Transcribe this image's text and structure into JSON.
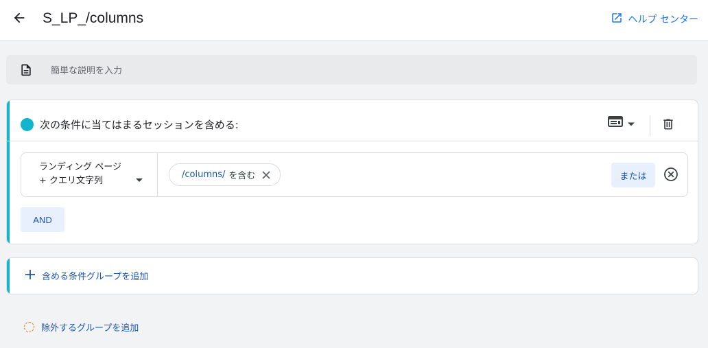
{
  "header": {
    "title": "S_LP_/columns",
    "help_label": "ヘルプ センター",
    "back_icon": "arrow-back-icon",
    "help_icon": "open-in-new-icon"
  },
  "description": {
    "placeholder": "簡単な説明を入力",
    "icon": "document-icon"
  },
  "include_group": {
    "title": "次の条件に当てはまるセッションを含める:",
    "accent_color": "#12b5cb",
    "condition": {
      "dimension": "ランディング ページ + クエリ文字列",
      "value": "/columns/",
      "operator": "を含む",
      "or_label": "または"
    },
    "and_label": "AND"
  },
  "add_include_label": "含める条件グループを追加",
  "add_exclude_label": "除外するグループを追加",
  "colors": {
    "link": "#1a73e8",
    "button_bg": "#e8f0fe",
    "exclude_accent": "#e8710a"
  }
}
